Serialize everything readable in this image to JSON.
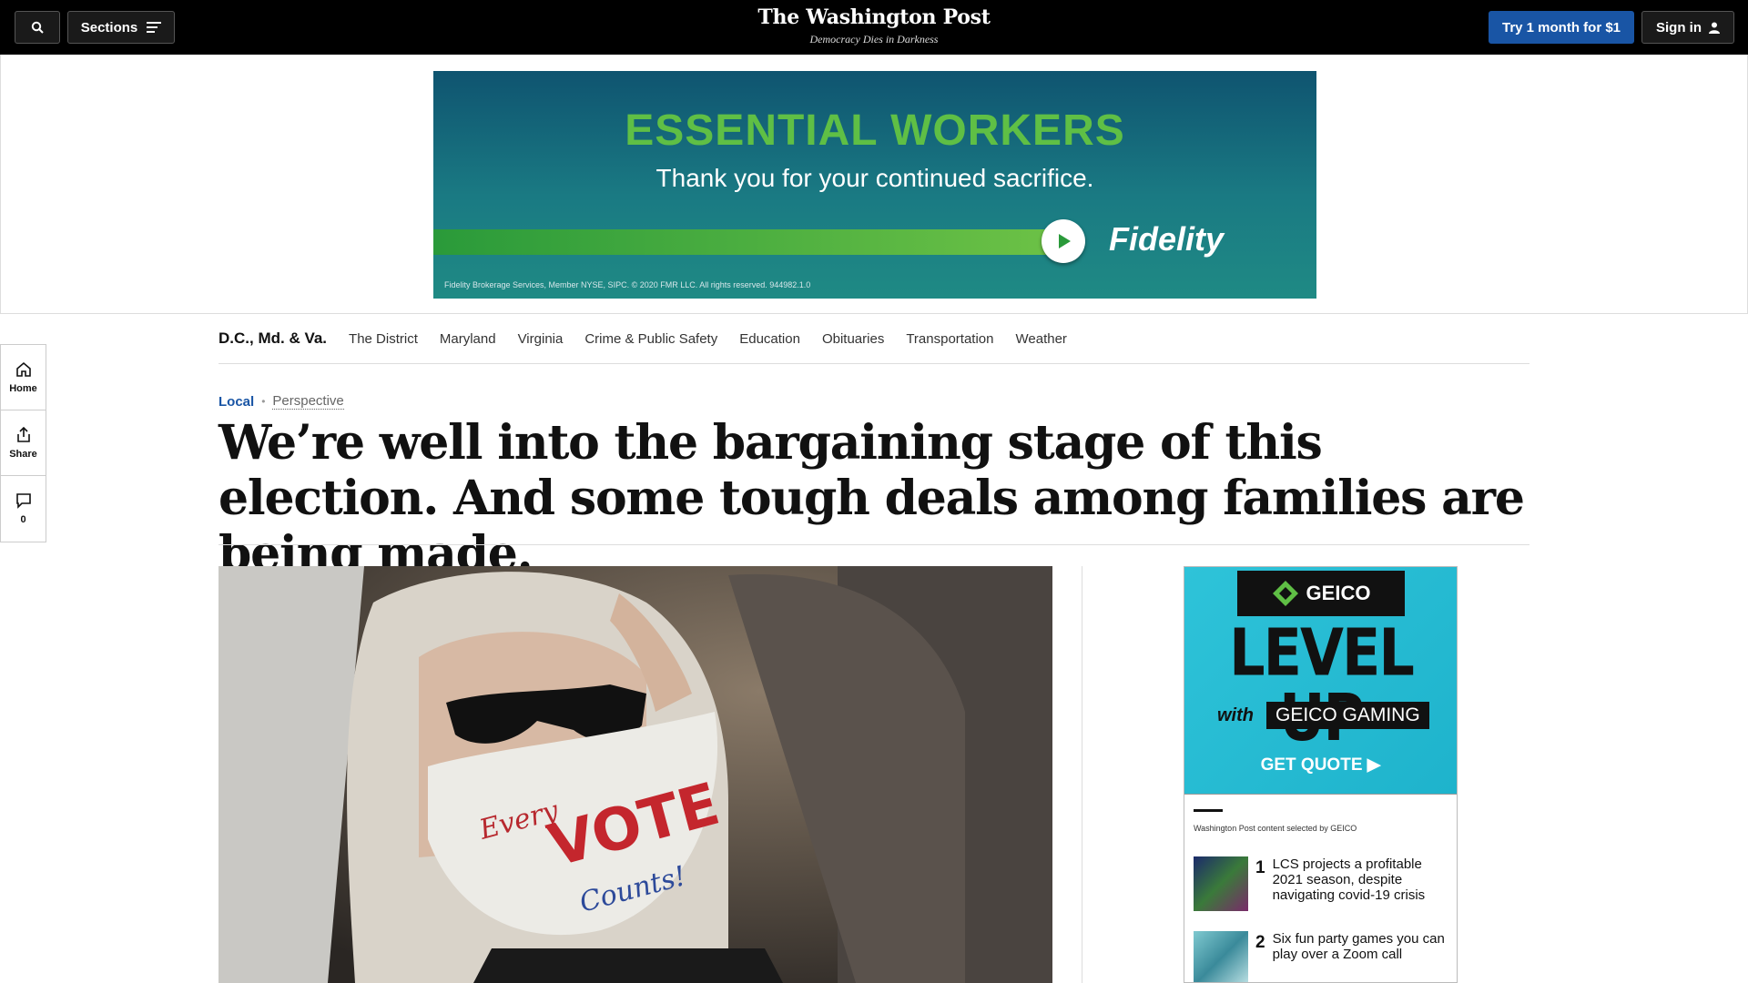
{
  "topbar": {
    "sections_label": "Sections",
    "logo": "The Washington Post",
    "tagline": "Democracy Dies in Darkness",
    "try_label": "Try 1 month for $1",
    "signin_label": "Sign in"
  },
  "ad_banner": {
    "headline": "ESSENTIAL WORKERS",
    "subline": "Thank you for your continued sacrifice.",
    "brand": "Fidelity",
    "fine_print": "Fidelity Brokerage Services, Member NYSE, SIPC. © 2020 FMR LLC. All rights reserved. 944982.1.0"
  },
  "left_rail": {
    "home": "Home",
    "share": "Share",
    "comments_count": "0"
  },
  "section_nav": {
    "title": "D.C., Md. & Va.",
    "links": [
      "The District",
      "Maryland",
      "Virginia",
      "Crime & Public Safety",
      "Education",
      "Obituaries",
      "Transportation",
      "Weather"
    ]
  },
  "article": {
    "kicker": "Local",
    "label": "Perspective",
    "headline": "We’re well into the bargaining stage of this election. And some tough deals among families are being made.",
    "photo_mask_text_1": "Every",
    "photo_mask_text_2": "VOTE",
    "photo_mask_text_3": "Counts!"
  },
  "right_ad": {
    "badge_brand": "GEICO",
    "badge_sub": "GAMING",
    "big_text": "LEVEL UP",
    "with": "with",
    "with_brand": "GEICO GAMING",
    "cta": "GET QUOTE",
    "credit": "Washington Post content selected by GEICO",
    "stories": [
      {
        "num": "1",
        "title": "LCS projects a profitable 2021 season, despite navigating covid-19 crisis"
      },
      {
        "num": "2",
        "title": "Six fun party games you can play over a Zoom call"
      }
    ]
  },
  "colors": {
    "accent_blue": "#1955a5",
    "topbar_bg": "#000000",
    "fidelity_green": "#5fbf45",
    "geico_cyan": "#2ec3d9"
  }
}
